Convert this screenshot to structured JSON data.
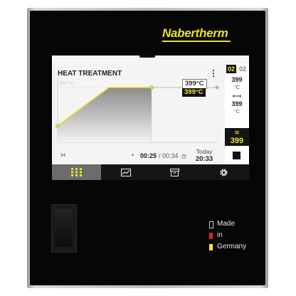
{
  "brand": {
    "name": "Nabertherm"
  },
  "screen": {
    "title": "HEAT TREATMENT",
    "menu_icon": "more-vertical-icon",
    "chart_ghost_label": "200 °C",
    "setpoint": "399°C",
    "actual": "399°C",
    "collapse_icon": "collapse-arrows-icon",
    "clock_icon": "segment-timer-icon",
    "elapsed": "00:25",
    "separator": " / ",
    "total": "00:34",
    "timer_icon": "stopwatch-icon",
    "today_label": "Today",
    "today_time": "20:33"
  },
  "side_panel": {
    "programs": [
      "02",
      "02"
    ],
    "target_value": "399",
    "target_unit": "°C",
    "ramp_icon": "ramp-arrows-icon",
    "ramp_value": "399",
    "ramp_unit": "°C",
    "heat_icon": "heating-icon",
    "heat_value": "399",
    "heat_unit": "°C",
    "stop_icon": "stop-icon"
  },
  "navbar": {
    "items": [
      {
        "name": "dashboard-grid-icon",
        "active": true
      },
      {
        "name": "chart-icon",
        "active": false
      },
      {
        "name": "archive-icon",
        "active": false
      },
      {
        "name": "settings-icon",
        "active": false
      }
    ]
  },
  "made_in": {
    "line1": "Made",
    "line2": "in",
    "line3": "Germany",
    "colors": [
      "#000000",
      "#dd2222",
      "#f0e62a"
    ]
  },
  "colors": {
    "accent": "#f0e62a",
    "panel": "#060606"
  }
}
